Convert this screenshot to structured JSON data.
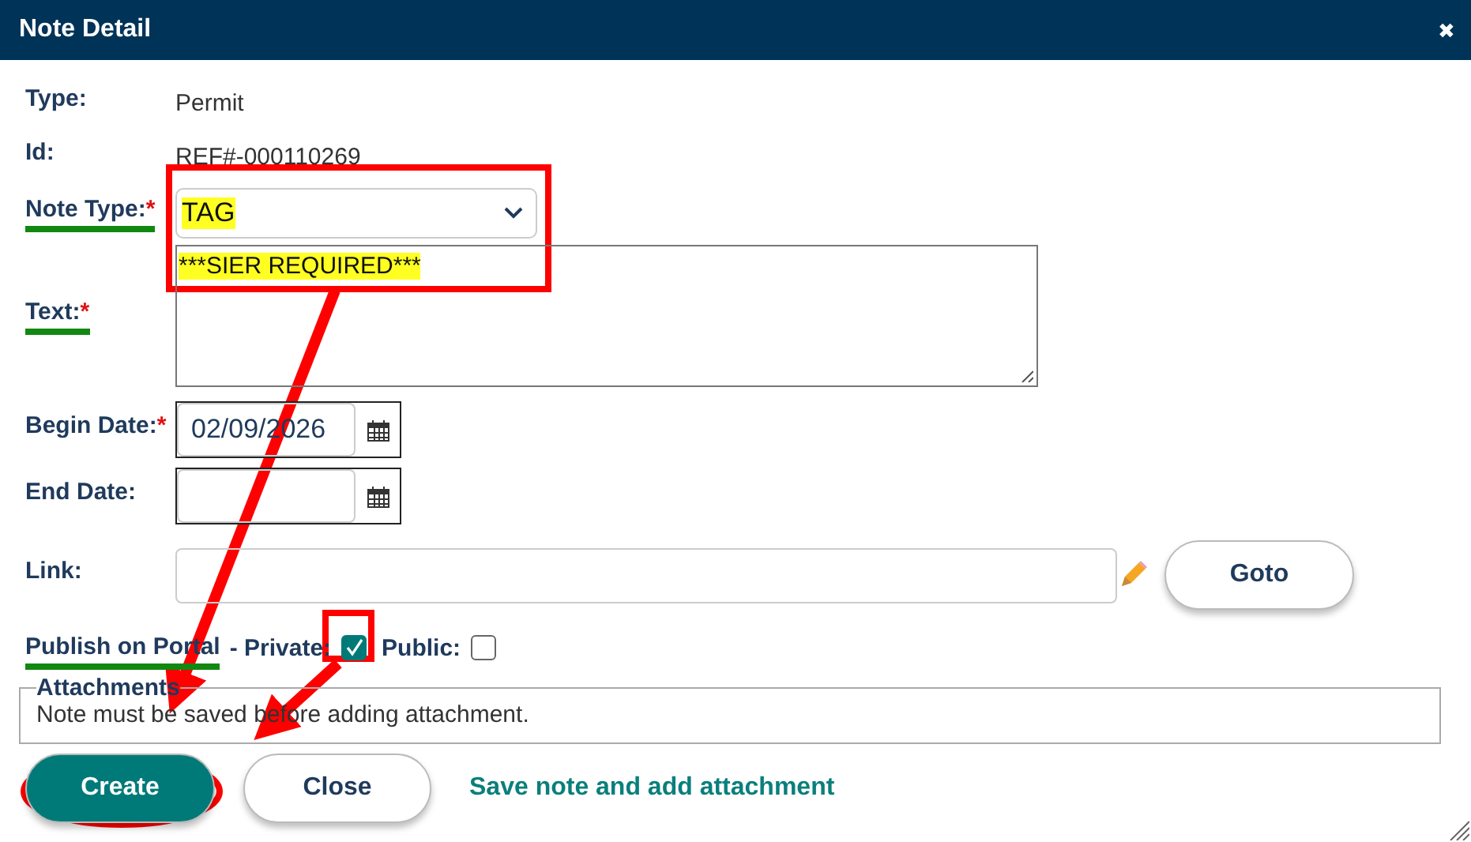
{
  "window": {
    "title": "Note Detail",
    "close": "✖"
  },
  "fields": [
    {
      "kind": "static",
      "label": "Type:",
      "value": "Permit",
      "underlined": false
    },
    {
      "kind": "static",
      "label": "Id:",
      "value": "REF#-000110269",
      "underlined": false
    },
    {
      "kind": "select",
      "label": "Note Type:",
      "marker": "*",
      "value": "TAG",
      "highlighted": true,
      "underlined": true
    },
    {
      "kind": "textarea",
      "label": "Text:",
      "marker": "*",
      "value": "***SIER REQUIRED***",
      "highlighted": true,
      "underlined": true
    },
    {
      "kind": "date",
      "label": "Begin Date:",
      "marker": "*",
      "value": "02/09/2026",
      "underlined": false
    },
    {
      "kind": "date",
      "label": "End Date:",
      "underlined": false
    },
    {
      "kind": "link",
      "label": "Link:",
      "button": "Goto",
      "underlined": false
    }
  ],
  "publish": {
    "label": "Publish on Portal",
    "underlined": true,
    "options": [
      {
        "label": "- Private:",
        "checked": true
      },
      {
        "label": "Public:",
        "checked": false
      }
    ]
  },
  "attachments": {
    "legend": "Attachments",
    "message": "Note must be saved before adding attachment."
  },
  "buttons": [
    {
      "label": "Create",
      "kind": "primary"
    },
    {
      "label": "Close",
      "kind": "secondary"
    }
  ],
  "link": "Save note and add attachment"
}
